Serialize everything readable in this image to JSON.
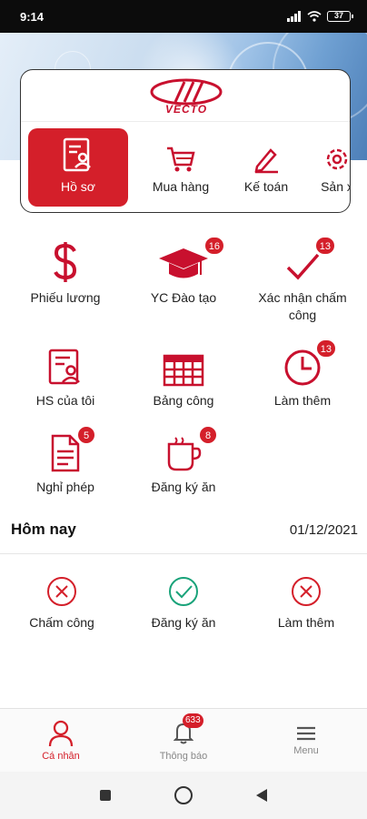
{
  "status_bar": {
    "time": "9:14",
    "battery": "37"
  },
  "logo": {
    "text": "VECTO"
  },
  "modules": [
    {
      "label": "Hồ sơ",
      "icon": "profile-doc-icon",
      "active": true
    },
    {
      "label": "Mua hàng",
      "icon": "cart-icon"
    },
    {
      "label": "Kế toán",
      "icon": "pencil-icon"
    },
    {
      "label": "Sản x",
      "icon": "gear-icon"
    }
  ],
  "features": [
    {
      "label": "Phiếu lương",
      "icon": "dollar-icon"
    },
    {
      "label": "YC Đào tạo",
      "icon": "graduation-cap-icon",
      "badge": "16"
    },
    {
      "label": "Xác nhận chấm công",
      "icon": "check-icon",
      "badge": "13"
    },
    {
      "label": "HS của tôi",
      "icon": "profile-doc-icon"
    },
    {
      "label": "Bảng công",
      "icon": "table-icon"
    },
    {
      "label": "Làm thêm",
      "icon": "clock-icon",
      "badge": "13"
    },
    {
      "label": "Nghỉ phép",
      "icon": "document-icon",
      "badge": "5"
    },
    {
      "label": "Đăng ký ăn",
      "icon": "coffee-cup-icon",
      "badge": "8"
    }
  ],
  "today": {
    "title": "Hôm nay",
    "date": "01/12/2021",
    "items": [
      {
        "label": "Chấm công",
        "status": "x-circle-icon",
        "color": "#d41f2a"
      },
      {
        "label": "Đăng ký ăn",
        "status": "check-circle-icon",
        "color": "#1aa37a"
      },
      {
        "label": "Làm thêm",
        "status": "x-circle-icon",
        "color": "#d41f2a"
      }
    ]
  },
  "bottom_nav": [
    {
      "label": "Cá nhân",
      "icon": "person-icon",
      "active": true
    },
    {
      "label": "Thông báo",
      "icon": "bell-icon",
      "badge": "633"
    },
    {
      "label": "Menu",
      "icon": "hamburger-icon"
    }
  ],
  "colors": {
    "accent": "#d41f2a",
    "success": "#1aa37a"
  }
}
